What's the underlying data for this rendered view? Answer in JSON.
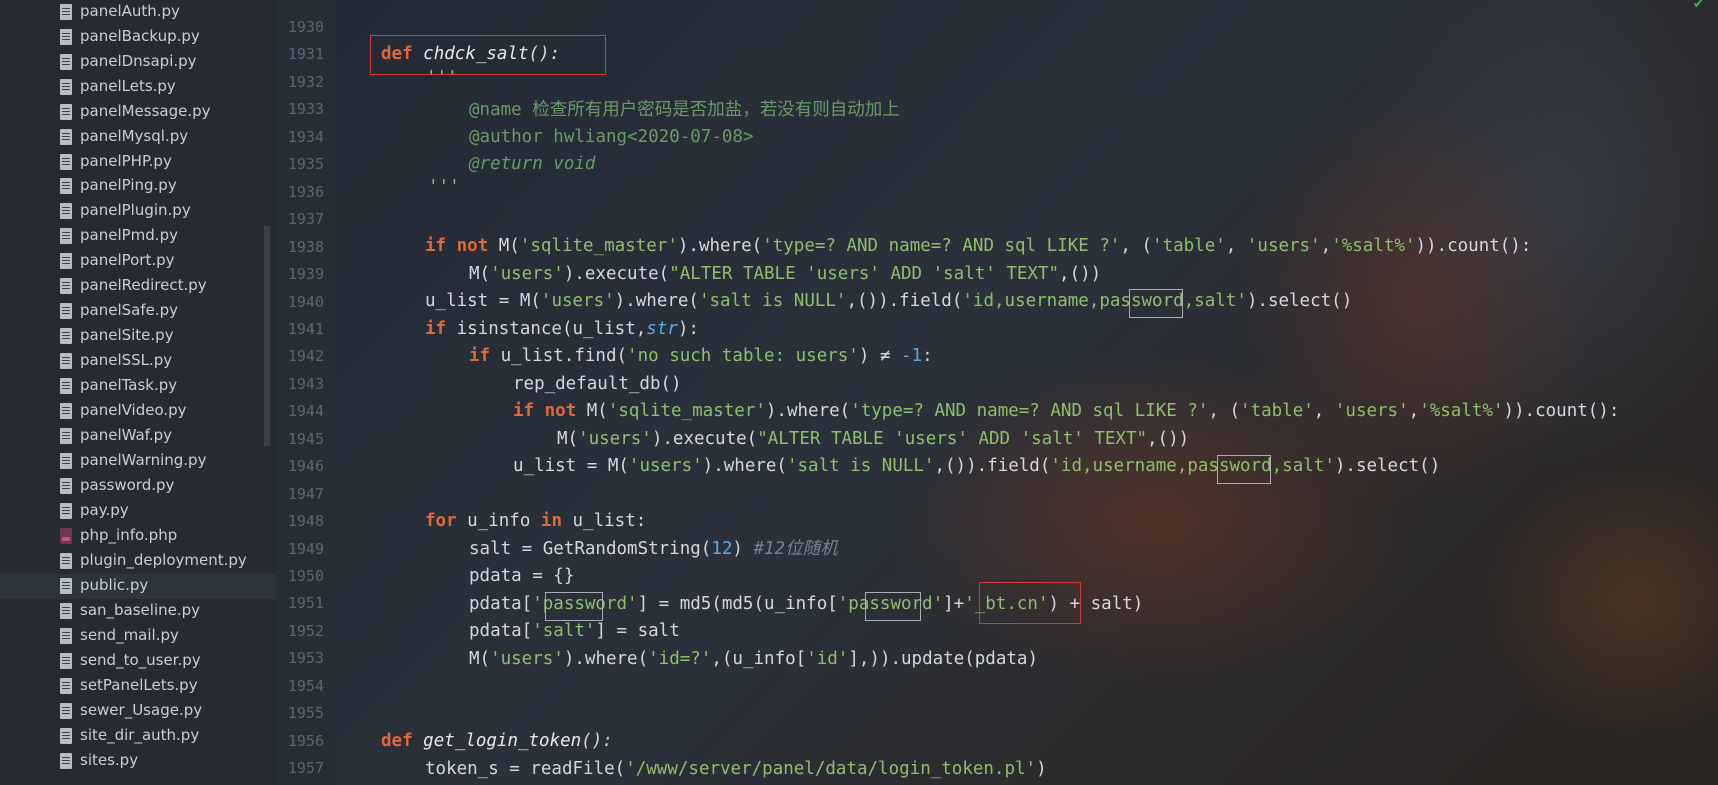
{
  "sidebar": {
    "files": [
      {
        "name": "panelAuth.py",
        "type": "py"
      },
      {
        "name": "panelBackup.py",
        "type": "py"
      },
      {
        "name": "panelDnsapi.py",
        "type": "py"
      },
      {
        "name": "panelLets.py",
        "type": "py"
      },
      {
        "name": "panelMessage.py",
        "type": "py"
      },
      {
        "name": "panelMysql.py",
        "type": "py"
      },
      {
        "name": "panelPHP.py",
        "type": "py"
      },
      {
        "name": "panelPing.py",
        "type": "py"
      },
      {
        "name": "panelPlugin.py",
        "type": "py"
      },
      {
        "name": "panelPmd.py",
        "type": "py"
      },
      {
        "name": "panelPort.py",
        "type": "py"
      },
      {
        "name": "panelRedirect.py",
        "type": "py"
      },
      {
        "name": "panelSafe.py",
        "type": "py"
      },
      {
        "name": "panelSite.py",
        "type": "py"
      },
      {
        "name": "panelSSL.py",
        "type": "py"
      },
      {
        "name": "panelTask.py",
        "type": "py"
      },
      {
        "name": "panelVideo.py",
        "type": "py"
      },
      {
        "name": "panelWaf.py",
        "type": "py"
      },
      {
        "name": "panelWarning.py",
        "type": "py"
      },
      {
        "name": "password.py",
        "type": "py"
      },
      {
        "name": "pay.py",
        "type": "py"
      },
      {
        "name": "php_info.php",
        "type": "php"
      },
      {
        "name": "plugin_deployment.py",
        "type": "py"
      },
      {
        "name": "public.py",
        "type": "py",
        "active": true
      },
      {
        "name": "san_baseline.py",
        "type": "py"
      },
      {
        "name": "send_mail.py",
        "type": "py"
      },
      {
        "name": "send_to_user.py",
        "type": "py"
      },
      {
        "name": "setPanelLets.py",
        "type": "py"
      },
      {
        "name": "sewer_Usage.py",
        "type": "py"
      },
      {
        "name": "site_dir_auth.py",
        "type": "py"
      },
      {
        "name": "sites.py",
        "type": "py"
      }
    ]
  },
  "editor": {
    "line_numbers": [
      "1930",
      "1931",
      "1932",
      "1933",
      "1934",
      "1935",
      "1936",
      "1937",
      "1938",
      "1939",
      "1940",
      "1941",
      "1942",
      "1943",
      "1944",
      "1945",
      "1946",
      "1947",
      "1948",
      "1949",
      "1950",
      "1951",
      "1952",
      "1953",
      "1954",
      "1955",
      "1956",
      "1957"
    ],
    "lines": {
      "l1931_kw": "def",
      "l1931_fn": "chdck_salt",
      "l1931_rest": "():",
      "l1932": "'''",
      "l1933_tag": "@name",
      "l1933_text": " 检查所有用户密码是否加盐，若没有则自动加上",
      "l1934_tag": "@author",
      "l1934_text": " hwliang<2020-07-08>",
      "l1935_tag": "@return",
      "l1935_text": " void",
      "l1936": "'''",
      "l1938_a": "if",
      "l1938_b": "not",
      "l1938_c": " M(",
      "l1938_d": "'sqlite_master'",
      "l1938_e": ").where(",
      "l1938_f": "'type=? AND name=? AND sql LIKE ?'",
      "l1938_g": ", (",
      "l1938_h": "'table'",
      "l1938_i": ", ",
      "l1938_j": "'users'",
      "l1938_k": ",",
      "l1938_l": "'%salt%'",
      "l1938_m": ")).count():",
      "l1939_a": "M(",
      "l1939_b": "'users'",
      "l1939_c": ").execute(",
      "l1939_d": "\"ALTER TABLE 'users' ADD 'salt' TEXT\"",
      "l1939_e": ",())",
      "l1940_a": "u_list = M(",
      "l1940_b": "'users'",
      "l1940_c": ").where(",
      "l1940_d": "'salt is NULL'",
      "l1940_e": ",()).field(",
      "l1940_f": "'id,username,password,salt'",
      "l1940_g": ").select()",
      "l1941_a": "if",
      "l1941_b": " isinstance(u_list,",
      "l1941_c": "str",
      "l1941_d": "):",
      "l1942_a": "if",
      "l1942_b": " u_list.find(",
      "l1942_c": "'no such table: users'",
      "l1942_d": ") ≠ ",
      "l1942_e": "-1",
      "l1942_f": ":",
      "l1943": "rep_default_db()",
      "l1944_a": "if",
      "l1944_b": "not",
      "l1944_c": " M(",
      "l1944_d": "'sqlite_master'",
      "l1944_e": ").where(",
      "l1944_f": "'type=? AND name=? AND sql LIKE ?'",
      "l1944_g": ", (",
      "l1944_h": "'table'",
      "l1944_i": ", ",
      "l1944_j": "'users'",
      "l1944_k": ",",
      "l1944_l": "'%salt%'",
      "l1944_m": ")).count():",
      "l1945_a": "M(",
      "l1945_b": "'users'",
      "l1945_c": ").execute(",
      "l1945_d": "\"ALTER TABLE 'users' ADD 'salt' TEXT\"",
      "l1945_e": ",())",
      "l1946_a": "u_list = M(",
      "l1946_b": "'users'",
      "l1946_c": ").where(",
      "l1946_d": "'salt is NULL'",
      "l1946_e": ",()).field(",
      "l1946_f": "'id,username,password,salt'",
      "l1946_g": ").select()",
      "l1948_a": "for",
      "l1948_b": " u_info ",
      "l1948_c": "in",
      "l1948_d": " u_list:",
      "l1949_a": "salt = GetRandomString(",
      "l1949_b": "12",
      "l1949_c": ") ",
      "l1949_d": "#12位随机",
      "l1950": "pdata = {}",
      "l1951_a": "pdata[",
      "l1951_b": "'password'",
      "l1951_c": "] = md5(md5(u_info[",
      "l1951_d": "'password'",
      "l1951_e": "]+",
      "l1951_f": "'_bt.cn'",
      "l1951_g": ") + salt)",
      "l1952_a": "pdata[",
      "l1952_b": "'salt'",
      "l1952_c": "] = salt",
      "l1953_a": "M(",
      "l1953_b": "'users'",
      "l1953_c": ").where(",
      "l1953_d": "'id=?'",
      "l1953_e": ",(u_info[",
      "l1953_f": "'id'",
      "l1953_g": "],)).update(pdata)",
      "l1956_kw": "def",
      "l1956_fn": "get_login_token",
      "l1956_rest": "():",
      "l1957_a": "token_s = readFile(",
      "l1957_b": "'/www/server/panel/data/login_token.pl'",
      "l1957_c": ")"
    }
  },
  "colors": {
    "keyword": "#e0693a",
    "string": "#8fbf6c",
    "number": "#5aa8e8",
    "highlight_box_red": "#d23a3a",
    "highlight_box_grey": "#a8aeb6"
  }
}
